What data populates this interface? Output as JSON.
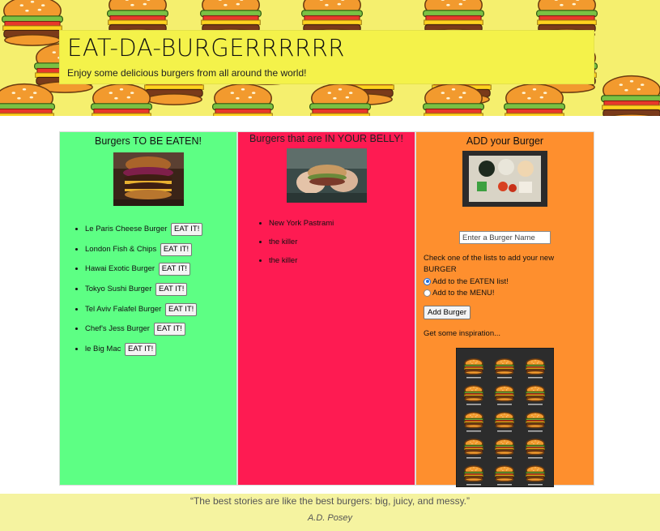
{
  "header": {
    "title": "EAT-DA-BURGERRRRRR",
    "subtitle": "Enjoy some delicious burgers from all around the world!"
  },
  "to_be_eaten": {
    "title": "Burgers TO BE EATEN!",
    "button_label": "EAT IT!",
    "items": [
      {
        "name": "Le Paris Cheese Burger"
      },
      {
        "name": "London Fish & Chips"
      },
      {
        "name": "Hawai Exotic Burger"
      },
      {
        "name": "Tokyo Sushi Burger"
      },
      {
        "name": "Tel Aviv Falafel Burger"
      },
      {
        "name": "Chef's Jess Burger"
      },
      {
        "name": "le Big Mac"
      }
    ]
  },
  "eaten": {
    "title": "Burgers that are IN YOUR BELLY!",
    "items": [
      {
        "name": "New York Pastrami"
      },
      {
        "name": "the killer"
      },
      {
        "name": "the killer"
      }
    ]
  },
  "add_form": {
    "title": "ADD your Burger",
    "input_placeholder": "Enter a Burger Name",
    "hint": "Check one of the lists to add your new BURGER",
    "radio_eaten": "Add to the EATEN list!",
    "radio_menu": "Add to the MENU!",
    "radio_selected": "Add to the EATEN list!",
    "submit_label": "Add Burger",
    "inspiration": "Get some inspiration..."
  },
  "footer": {
    "quote": "“The best stories are like the best burgers: big, juicy, and messy.”",
    "author": "A.D. Posey"
  },
  "colors": {
    "banner": "#f5ef6e",
    "jumbotron": "#f4f24a",
    "col_to_be_eaten": "#5dff84",
    "col_eaten": "#fe1b52",
    "col_add": "#fe8f2e",
    "footer": "#f5f3a0"
  }
}
